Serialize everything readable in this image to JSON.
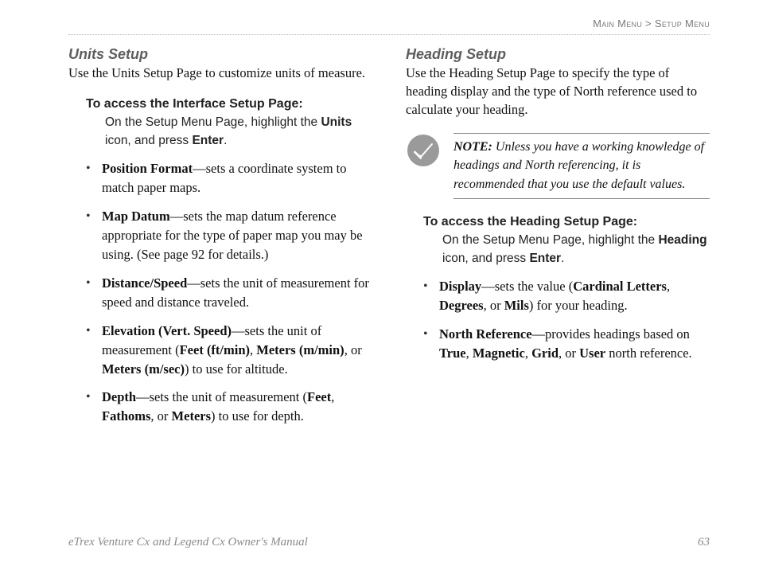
{
  "breadcrumb": {
    "left": "Main Menu",
    "sep": ">",
    "right": "Setup Menu"
  },
  "left": {
    "title": "Units Setup",
    "lead": "Use the Units Setup Page to customize units of measure.",
    "instr_title": "To access the Interface Setup Page:",
    "instr_pre": "On the Setup Menu Page, highlight the ",
    "instr_b1": "Units",
    "instr_mid": " icon, and press ",
    "instr_b2": "Enter",
    "instr_post": ".",
    "items": [
      {
        "term": "Position Format",
        "rest": "—sets a coordinate system to match paper maps."
      },
      {
        "term": "Map Datum",
        "rest": "—sets the map datum reference appropriate for the type of paper map you may be using. (See page 92 for details.)"
      },
      {
        "term": "Distance/Speed",
        "rest": "—sets the unit of measurement for speed and distance traveled."
      },
      {
        "term": "Elevation (Vert. Speed)",
        "rest_pre": "—sets the unit of measurement (",
        "opts": [
          "Feet (ft/min)",
          "Meters (m/min)",
          "Meters (m/sec)"
        ],
        "joins": [
          ", ",
          ", or "
        ],
        "rest_post": ") to use for altitude."
      },
      {
        "term": "Depth",
        "rest_pre": "—sets the unit of measurement (",
        "opts": [
          "Feet",
          "Fathoms",
          "Meters"
        ],
        "joins": [
          ", ",
          ", or "
        ],
        "rest_post": ") to use for depth."
      }
    ]
  },
  "right": {
    "title": "Heading Setup",
    "lead": "Use the Heading Setup Page to specify the type of heading display and the type of North reference used to calculate your heading.",
    "note_label": "NOTE:",
    "note_text": " Unless you have a working knowledge of headings and North referencing, it is recommended that you use the default values.",
    "instr_title": "To access the Heading Setup Page:",
    "instr_pre": "On the Setup Menu Page, highlight the ",
    "instr_b1": "Heading",
    "instr_mid": " icon, and press ",
    "instr_b2": "Enter",
    "instr_post": ".",
    "items": [
      {
        "term": "Display",
        "rest_pre": "—sets the value (",
        "opts": [
          "Cardinal Letters",
          "Degrees",
          "Mils"
        ],
        "joins": [
          ", ",
          ", or "
        ],
        "rest_post": ") for your heading."
      },
      {
        "term": "North Reference",
        "rest_pre": "—provides headings based on ",
        "opts": [
          "True",
          "Magnetic",
          "Grid",
          "User"
        ],
        "joins": [
          ", ",
          ", ",
          ", or "
        ],
        "rest_post": " north reference."
      }
    ]
  },
  "footer": {
    "left": "eTrex Venture Cx and Legend Cx Owner's Manual",
    "page": "63"
  }
}
